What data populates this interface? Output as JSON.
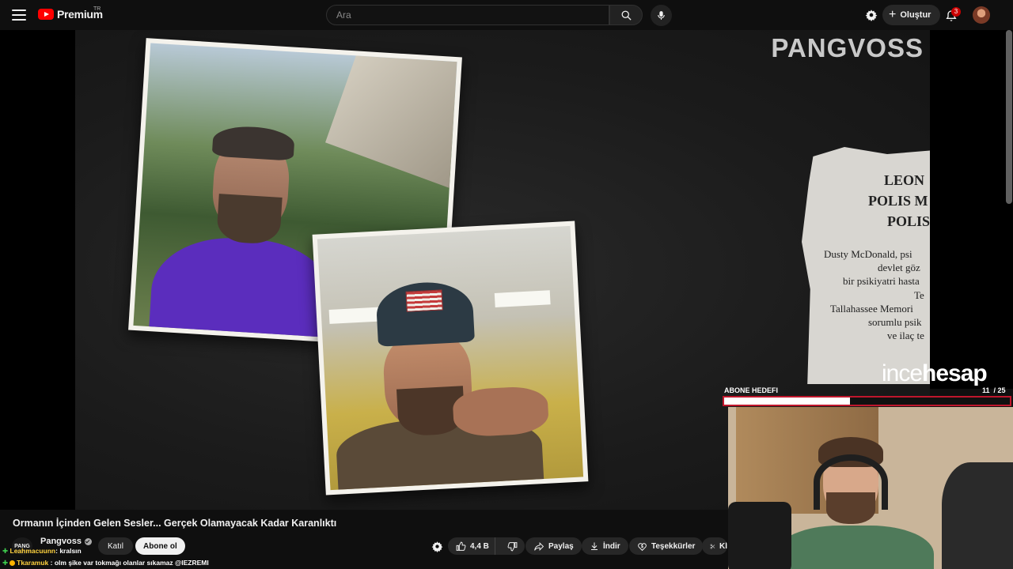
{
  "header": {
    "logo_text": "Premium",
    "logo_region": "TR",
    "search_placeholder": "Ara",
    "create_label": "Oluştur",
    "notification_count": "3"
  },
  "video": {
    "channel_watermark": "PANGVOSS",
    "newspaper": {
      "headline_lines": [
        "LEON",
        "POLIS M",
        "POLIS"
      ],
      "body_lines": [
        "Dusty McDonald, psi",
        "devlet göz",
        "bir psikiyatri hasta",
        "Te",
        "Tallahassee Memori",
        "sorumlu psik",
        "ve ilaç te"
      ]
    },
    "overlay": {
      "brand_light": "ince",
      "brand_bold": "hesap",
      "goal_label": "ABONE HEDEFI",
      "goal_current": "11",
      "goal_total": "/ 25",
      "goal_progress": 0.44
    }
  },
  "info": {
    "title": "Ormanın İçinden Gelen Sesler... Gerçek Olamayacak Kadar Karanlıktı",
    "channel_name": "Pangvoss",
    "channel_avatar_text": "PANG",
    "join_label": "Katıl",
    "subscribe_label": "Abone ol",
    "like_count": "4,4 B",
    "share_label": "Paylaş",
    "download_label": "İndir",
    "thanks_label": "Teşekkürler",
    "clip_label": "Kl"
  },
  "chat": [
    {
      "user": "Leahmacuunn",
      "message": ": kralsın"
    },
    {
      "user": "Tkaramuk",
      "message": ": olm şike var tokmağı olanlar sıkamaz @IEZREMI"
    }
  ],
  "colors": {
    "brand_red": "#ff0000",
    "goal_border": "#c0162c",
    "subscribe_bg": "#f1f1f1"
  }
}
